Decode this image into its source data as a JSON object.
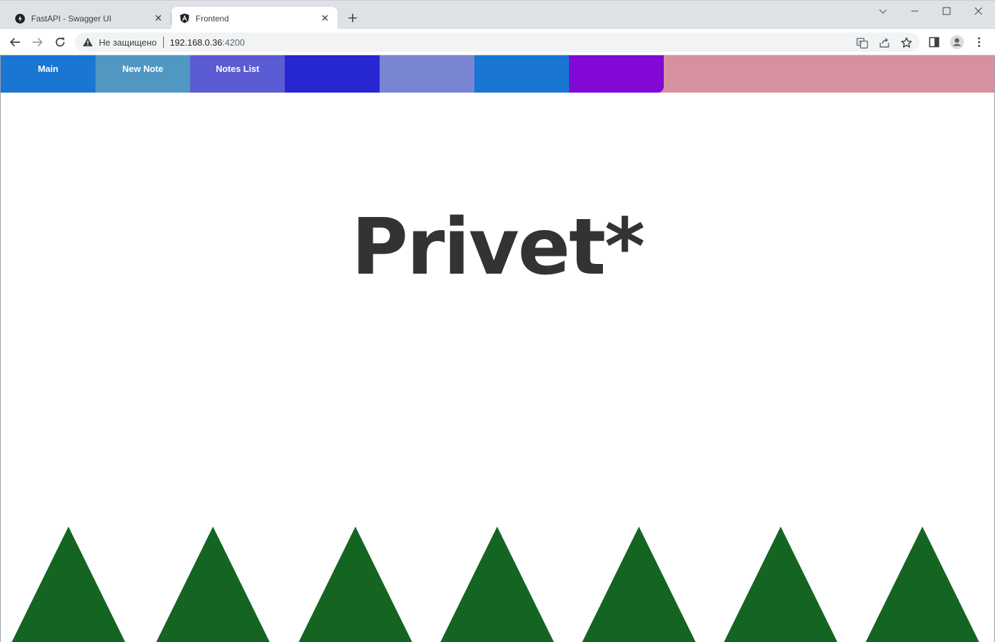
{
  "browser": {
    "tabs": [
      {
        "title": "FastAPI - Swagger UI",
        "icon": "fastapi-icon"
      },
      {
        "title": "Frontend",
        "icon": "angular-icon",
        "active": true
      }
    ],
    "address": {
      "security_label": "Не защищено",
      "host": "192.168.0.36",
      "port": ":4200"
    }
  },
  "nav": {
    "items": [
      {
        "label": "Main",
        "color": "#1976d2"
      },
      {
        "label": "New Note",
        "color": "#5097c2"
      },
      {
        "label": "Notes List",
        "color": "#5b5bd4"
      },
      {
        "label": "",
        "color": "#2626d2"
      },
      {
        "label": "",
        "color": "#7984d2"
      },
      {
        "label": "",
        "color": "#1976d2"
      },
      {
        "label": "",
        "color": "#8208d6"
      }
    ],
    "background": "#d691a0"
  },
  "main": {
    "heading": "Privet*"
  },
  "decoration": {
    "tree_color": "#146522",
    "tree_count": 7
  }
}
